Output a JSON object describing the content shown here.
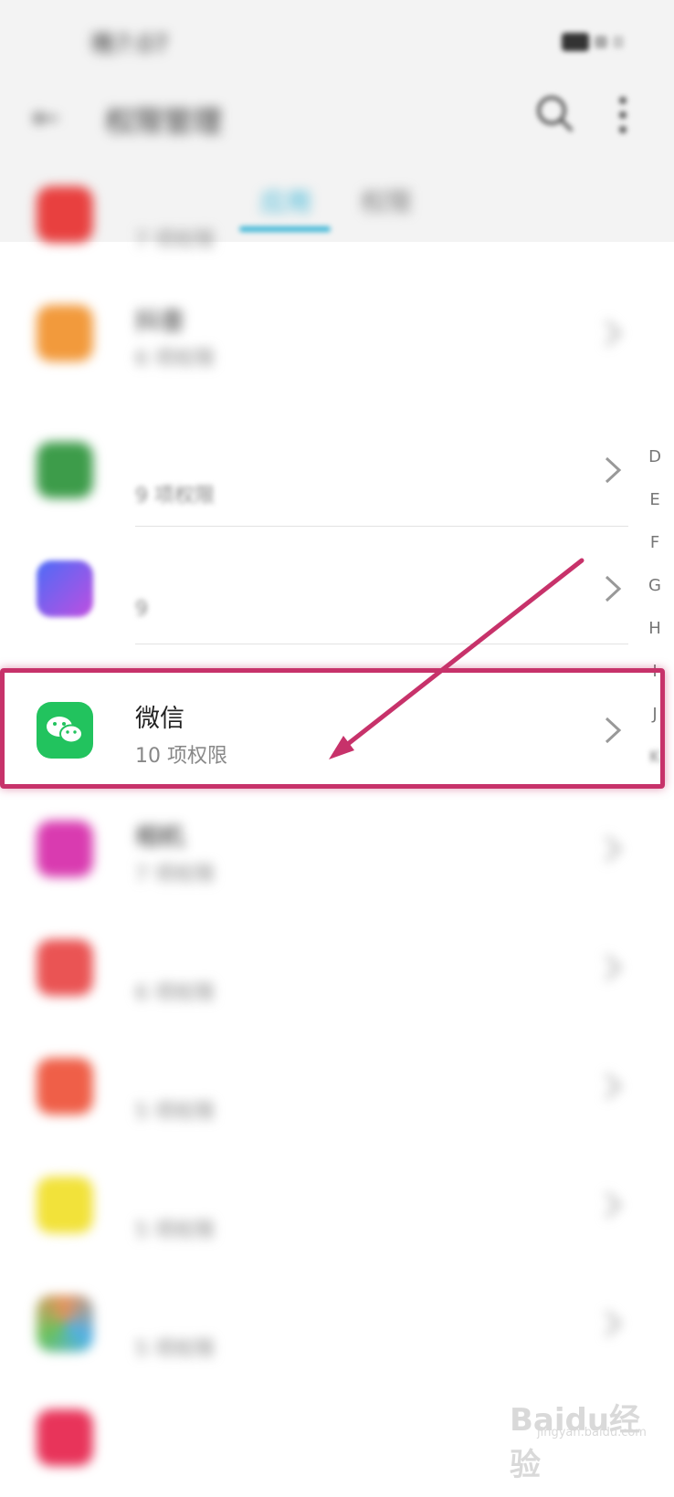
{
  "status_bar": {
    "time": "晚7:07"
  },
  "header": {
    "title": "权限管理",
    "tabs": [
      {
        "label": "应用"
      },
      {
        "label": "权限"
      }
    ]
  },
  "apps": [
    {
      "name": "",
      "permissions": "7 项权限",
      "color": "#e8403f"
    },
    {
      "name": "抖音",
      "permissions": "6 项权限",
      "color": "#f29a3c"
    },
    {
      "name": "",
      "permissions": "9 项权限",
      "color": "#3d9c4a"
    },
    {
      "name": "",
      "permissions": "9",
      "color": "#6a4ef0"
    },
    {
      "name": "微信",
      "permissions": "10 项权限",
      "color": "#22c35e"
    },
    {
      "name": "相机",
      "permissions": "7 项权限",
      "color": "#d93bb0"
    },
    {
      "name": "",
      "permissions": "6 项权限",
      "color": "#ea5454"
    },
    {
      "name": "",
      "permissions": "5 项权限",
      "color": "#ef5f48"
    },
    {
      "name": "",
      "permissions": "5 项权限",
      "color": "#f2e23a"
    },
    {
      "name": "",
      "permissions": "5 项权限",
      "color": "#e8915a"
    },
    {
      "name": "",
      "permissions": "",
      "color": "#e8345a"
    }
  ],
  "index_letters": [
    "D",
    "E",
    "F",
    "G",
    "H",
    "I",
    "J",
    "K"
  ],
  "annotation": {
    "highlight_color": "#c7326a"
  },
  "watermark": {
    "brand": "Baidu经验",
    "url": "jingyan.baidu.com"
  }
}
